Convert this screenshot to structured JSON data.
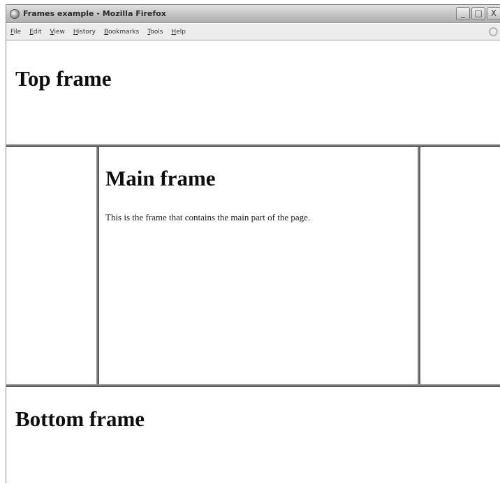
{
  "window": {
    "title": "Frames example - Mozilla Firefox",
    "icon": "firefox-globe-icon",
    "controls": {
      "minimize": "_",
      "maximize": "□",
      "close": "X"
    }
  },
  "menubar": {
    "items": [
      {
        "label": "File"
      },
      {
        "label": "Edit"
      },
      {
        "label": "View"
      },
      {
        "label": "History"
      },
      {
        "label": "Bookmarks"
      },
      {
        "label": "Tools"
      },
      {
        "label": "Help"
      }
    ],
    "throbber_icon": "throbber-icon"
  },
  "frames": {
    "top": {
      "heading": "Top frame"
    },
    "main": {
      "heading": "Main frame",
      "paragraph": "This is the frame that contains the main part of the page."
    },
    "bottom": {
      "heading": "Bottom frame"
    }
  }
}
